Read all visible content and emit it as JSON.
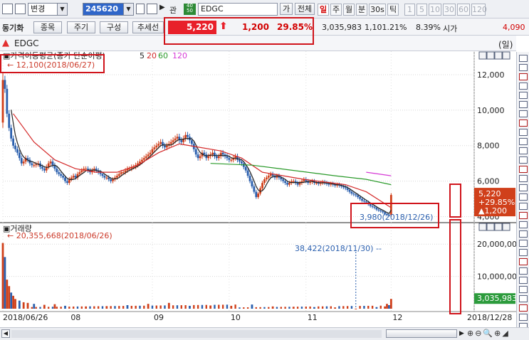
{
  "toolbar": {
    "account_combo": "변경",
    "stock_code": "245620",
    "relation_label": "관",
    "stock_name": "EDGC",
    "ga_label": "가",
    "all_label": "전체",
    "periods": [
      "일",
      "주",
      "월",
      "분",
      "30s",
      "틱"
    ],
    "numbers": [
      "1",
      "5",
      "10",
      "30",
      "60",
      "120"
    ],
    "active_period": "일"
  },
  "toolbar2": {
    "left_label": "동기화",
    "tabs": [
      "종목",
      "주기",
      "구성",
      "추세선"
    ],
    "price": "5,220",
    "change": "1,200",
    "change_pct": "29.85%",
    "volume": "3,035,983",
    "vol_ratio": "1,101.21%",
    "turnover": "8.39%",
    "open_label": "시가",
    "open_value": "4,090"
  },
  "chart_header": {
    "name": "EDGC",
    "period_label": "(일)",
    "price_panel_title": "가격이동평균(종가 단순이평)",
    "ma_labels": [
      "5",
      "20",
      "60",
      "120"
    ],
    "ma_colors": [
      "#222222",
      "#d42a2a",
      "#2a9a2a",
      "#d63ad6"
    ],
    "high_annotation": "12,100(2018/06/27)",
    "low_annotation": "3,980(2018/12/26)",
    "price_tag": [
      "5,220",
      "+29.85%",
      "▲1,200"
    ],
    "volume_panel_title": "거래량",
    "volume_max_annotation": "20,355,668(2018/06/26)",
    "volume_mid_annotation": "38,422(2018/11/30)",
    "volume_tag": "3,035,983",
    "x_start": "2018/06/26",
    "x_end": "2018/12/28"
  },
  "colors": {
    "up": "#d0401b",
    "down": "#2a5fae",
    "highlight": "#d0141b"
  },
  "chart_data": {
    "type": "candlestick",
    "price_axis": {
      "ticks": [
        "12,000",
        "10,000",
        "8,000",
        "6,000",
        "4,000"
      ],
      "tick_values": [
        12000,
        10000,
        8000,
        6000,
        4000
      ],
      "range": [
        3700,
        13000
      ]
    },
    "volume_axis": {
      "ticks": [
        "20,000,000",
        "10,000,000"
      ],
      "tick_values": [
        20000000,
        10000000
      ],
      "range": [
        0,
        26000000
      ]
    },
    "x_ticks": [
      "2018/06/26",
      "08",
      "09",
      "10",
      "11",
      "12",
      "2018/12/28"
    ],
    "x_tick_days": [
      0,
      32,
      72,
      109,
      146,
      187,
      227
    ],
    "close_series": [
      [
        0,
        11700
      ],
      [
        1,
        11200
      ],
      [
        2,
        9800
      ],
      [
        3,
        9000
      ],
      [
        4,
        8400
      ],
      [
        5,
        8000
      ],
      [
        6,
        7800
      ],
      [
        7,
        7600
      ],
      [
        8,
        7300
      ],
      [
        9,
        7000
      ],
      [
        10,
        7100
      ],
      [
        11,
        7300
      ],
      [
        12,
        7200
      ],
      [
        13,
        7000
      ],
      [
        14,
        6900
      ],
      [
        15,
        6900
      ],
      [
        16,
        6950
      ],
      [
        17,
        7000
      ],
      [
        18,
        6800
      ],
      [
        19,
        6700
      ],
      [
        20,
        6600
      ],
      [
        21,
        6800
      ],
      [
        22,
        7000
      ],
      [
        23,
        7100
      ],
      [
        24,
        6900
      ],
      [
        25,
        6700
      ],
      [
        26,
        6500
      ],
      [
        27,
        6400
      ],
      [
        28,
        6300
      ],
      [
        29,
        6200
      ],
      [
        30,
        6000
      ],
      [
        31,
        5900
      ],
      [
        32,
        6100
      ],
      [
        33,
        6200
      ],
      [
        34,
        6300
      ],
      [
        35,
        6200
      ],
      [
        36,
        6400
      ],
      [
        37,
        6500
      ],
      [
        38,
        6600
      ],
      [
        39,
        6700
      ],
      [
        40,
        6700
      ],
      [
        41,
        6600
      ],
      [
        42,
        6500
      ],
      [
        43,
        6600
      ],
      [
        44,
        6700
      ],
      [
        45,
        6600
      ],
      [
        46,
        6500
      ],
      [
        47,
        6400
      ],
      [
        48,
        6300
      ],
      [
        49,
        6200
      ],
      [
        50,
        6200
      ],
      [
        51,
        6100
      ],
      [
        52,
        6000
      ],
      [
        53,
        6100
      ],
      [
        54,
        6200
      ],
      [
        55,
        6300
      ],
      [
        56,
        6400
      ],
      [
        57,
        6500
      ],
      [
        58,
        6500
      ],
      [
        59,
        6600
      ],
      [
        60,
        6700
      ],
      [
        61,
        6700
      ],
      [
        62,
        6800
      ],
      [
        63,
        6800
      ],
      [
        64,
        6900
      ],
      [
        65,
        7000
      ],
      [
        66,
        7100
      ],
      [
        67,
        7200
      ],
      [
        68,
        7300
      ],
      [
        69,
        7400
      ],
      [
        70,
        7500
      ],
      [
        71,
        7600
      ],
      [
        72,
        7800
      ],
      [
        73,
        7900
      ],
      [
        74,
        8000
      ],
      [
        75,
        8100
      ],
      [
        76,
        8200
      ],
      [
        77,
        8000
      ],
      [
        78,
        7900
      ],
      [
        79,
        8000
      ],
      [
        80,
        8100
      ],
      [
        81,
        8200
      ],
      [
        82,
        8300
      ],
      [
        83,
        8400
      ],
      [
        84,
        8500
      ],
      [
        85,
        8300
      ],
      [
        86,
        8200
      ],
      [
        87,
        8400
      ],
      [
        88,
        8600
      ],
      [
        89,
        8500
      ],
      [
        90,
        8300
      ],
      [
        91,
        8100
      ],
      [
        92,
        7800
      ],
      [
        93,
        7500
      ],
      [
        94,
        7300
      ],
      [
        95,
        7400
      ],
      [
        96,
        7600
      ],
      [
        97,
        7500
      ],
      [
        98,
        7300
      ],
      [
        99,
        7400
      ],
      [
        100,
        7500
      ],
      [
        101,
        7600
      ],
      [
        102,
        7400
      ],
      [
        103,
        7300
      ],
      [
        104,
        7400
      ],
      [
        105,
        7600
      ],
      [
        106,
        7500
      ],
      [
        107,
        7400
      ],
      [
        108,
        7300
      ],
      [
        109,
        7200
      ],
      [
        110,
        7200
      ],
      [
        111,
        7300
      ],
      [
        112,
        7400
      ],
      [
        113,
        7200
      ],
      [
        114,
        7100
      ],
      [
        115,
        7000
      ],
      [
        116,
        6800
      ],
      [
        117,
        6600
      ],
      [
        118,
        6300
      ],
      [
        119,
        6000
      ],
      [
        120,
        5700
      ],
      [
        121,
        5400
      ],
      [
        122,
        5100
      ],
      [
        123,
        5300
      ],
      [
        124,
        5600
      ],
      [
        125,
        5900
      ],
      [
        126,
        6100
      ],
      [
        127,
        6200
      ],
      [
        128,
        6300
      ],
      [
        129,
        6400
      ],
      [
        130,
        6300
      ],
      [
        131,
        6200
      ],
      [
        132,
        6300
      ],
      [
        133,
        6200
      ],
      [
        134,
        6100
      ],
      [
        135,
        6000
      ],
      [
        136,
        5900
      ],
      [
        137,
        5800
      ],
      [
        138,
        5900
      ],
      [
        139,
        6000
      ],
      [
        140,
        6000
      ],
      [
        141,
        5900
      ],
      [
        142,
        5800
      ],
      [
        143,
        5900
      ],
      [
        144,
        6000
      ],
      [
        145,
        6100
      ],
      [
        146,
        6000
      ],
      [
        147,
        5900
      ],
      [
        148,
        5950
      ],
      [
        149,
        6000
      ],
      [
        150,
        5900
      ],
      [
        151,
        5900
      ],
      [
        152,
        5850
      ],
      [
        153,
        5900
      ],
      [
        154,
        5950
      ],
      [
        155,
        5900
      ],
      [
        156,
        5850
      ],
      [
        157,
        5800
      ],
      [
        158,
        5850
      ],
      [
        159,
        5800
      ],
      [
        160,
        5750
      ],
      [
        161,
        5800
      ],
      [
        162,
        5750
      ],
      [
        163,
        5700
      ],
      [
        164,
        5650
      ],
      [
        165,
        5600
      ],
      [
        166,
        5500
      ],
      [
        167,
        5400
      ],
      [
        168,
        5300
      ],
      [
        169,
        5250
      ],
      [
        170,
        5200
      ],
      [
        171,
        5100
      ],
      [
        172,
        5000
      ],
      [
        173,
        4900
      ],
      [
        174,
        4850
      ],
      [
        175,
        4800
      ],
      [
        176,
        4700
      ],
      [
        177,
        4600
      ],
      [
        178,
        4550
      ],
      [
        179,
        4500
      ],
      [
        180,
        4400
      ],
      [
        181,
        4350
      ],
      [
        182,
        4300
      ],
      [
        183,
        4250
      ],
      [
        184,
        4150
      ],
      [
        185,
        4100
      ],
      [
        186,
        4090
      ],
      [
        187,
        5220
      ]
    ],
    "ma20": [
      [
        5,
        9800
      ],
      [
        15,
        8200
      ],
      [
        25,
        7200
      ],
      [
        35,
        6700
      ],
      [
        45,
        6500
      ],
      [
        55,
        6500
      ],
      [
        65,
        6900
      ],
      [
        75,
        7600
      ],
      [
        85,
        8100
      ],
      [
        95,
        7900
      ],
      [
        105,
        7700
      ],
      [
        115,
        7300
      ],
      [
        125,
        6500
      ],
      [
        135,
        6300
      ],
      [
        145,
        6100
      ],
      [
        155,
        5950
      ],
      [
        165,
        5800
      ],
      [
        175,
        5400
      ],
      [
        187,
        4500
      ]
    ],
    "ma60": [
      [
        100,
        7000
      ],
      [
        120,
        6900
      ],
      [
        140,
        6600
      ],
      [
        160,
        6300
      ],
      [
        175,
        6100
      ],
      [
        187,
        5800
      ]
    ],
    "ma120": [
      [
        175,
        6500
      ],
      [
        187,
        6300
      ]
    ],
    "volume_days": [
      0,
      1,
      2,
      3,
      4,
      5,
      6,
      8,
      10,
      12,
      15,
      20,
      25,
      30,
      40,
      50,
      60,
      70,
      80,
      90,
      100,
      110,
      120,
      130,
      140,
      150,
      160,
      170,
      180,
      184,
      185,
      186,
      187
    ],
    "volume_values": [
      20355668,
      16000000,
      9000000,
      7000000,
      5000000,
      4000000,
      3000000,
      2500000,
      2000000,
      1800000,
      1500000,
      1200000,
      1400000,
      900000,
      700000,
      800000,
      1100000,
      1500000,
      1800000,
      900000,
      1000000,
      900000,
      1300000,
      700000,
      600000,
      500000,
      400000,
      38422,
      500000,
      700000,
      1500000,
      1100000,
      3035983
    ],
    "high": {
      "day": 1,
      "value": 12100,
      "date": "2018/06/27"
    },
    "low": {
      "day": 186,
      "value": 3980,
      "date": "2018/12/26"
    },
    "last": {
      "close": 5220,
      "change": 1200,
      "change_pct": 29.85
    }
  }
}
